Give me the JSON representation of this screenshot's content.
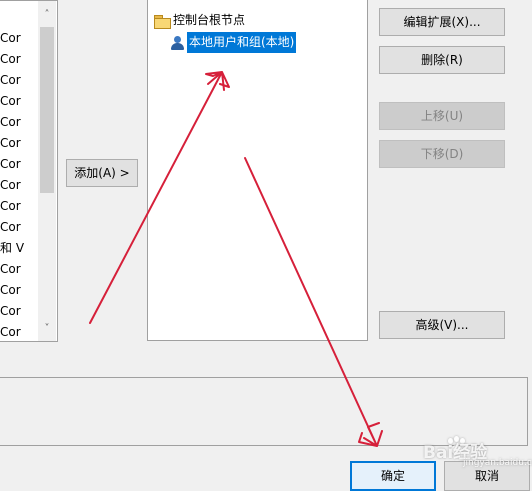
{
  "available_list": {
    "items": [
      "Cor",
      "Cor",
      "Cor",
      "Cor",
      "Cor",
      "Cor",
      "Cor",
      "Cor",
      "Cor",
      "Cor",
      "和 V",
      "Cor",
      "Cor",
      "Cor",
      "Cor"
    ],
    "scroll_up_glyph": "˄",
    "scroll_down_glyph": "˅"
  },
  "add_button": {
    "label": "添加(A) >"
  },
  "tree": {
    "root_label": "控制台根节点",
    "child_label": "本地用户和组(本地)"
  },
  "buttons": {
    "edit_extensions": "编辑扩展(X)...",
    "delete": "删除(R)",
    "move_up": "上移(U)",
    "move_down": "下移(D)",
    "advanced": "高级(V)...",
    "ok": "确定",
    "cancel": "取消"
  },
  "watermark": {
    "text": "Bai经验",
    "sub": "jingyan.baidu.com"
  },
  "colors": {
    "selection": "#0078d7",
    "annotation_arrow": "#d6203a",
    "disabled_text": "#838383"
  },
  "icons": {
    "folder": "folder-icon",
    "users": "users-group-icon"
  }
}
